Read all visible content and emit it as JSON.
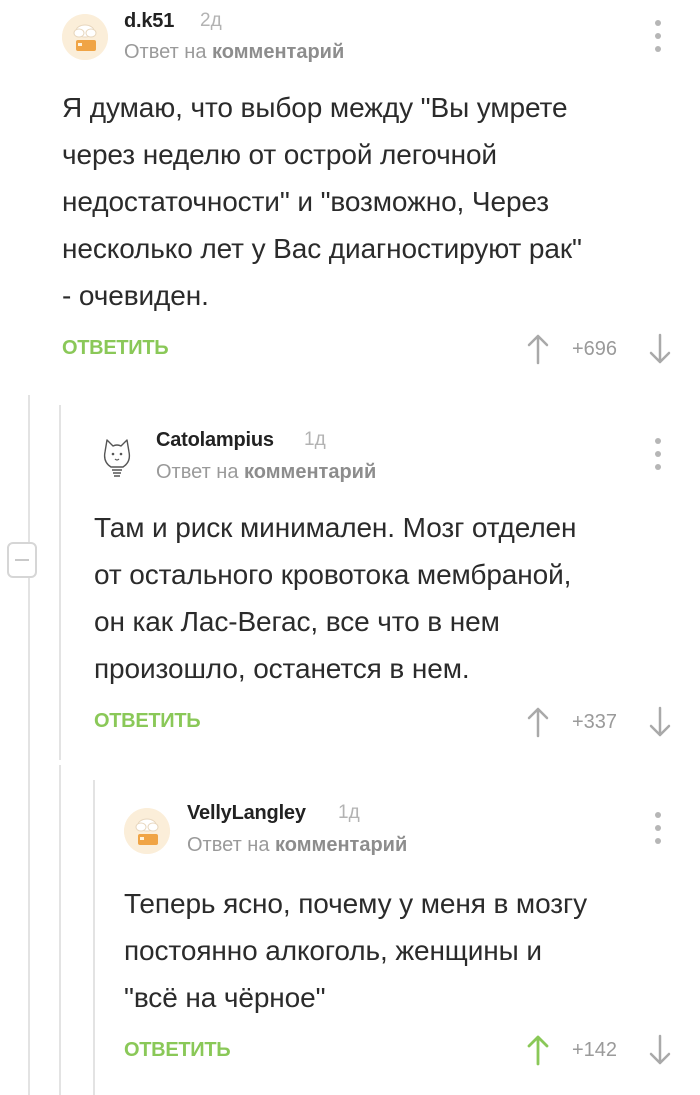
{
  "reply_label_prefix": "Ответ на",
  "reply_label_link": "комментарий",
  "reply_button": "ОТВЕТИТЬ",
  "colors": {
    "accent": "#8ac858",
    "upvote_active": "#8ac858",
    "muted": "#b3b3b3"
  },
  "comments": [
    {
      "username": "d.k51",
      "time": "2д",
      "avatar": "chef-hat-avatar",
      "lines": [
        "Я думаю, что выбор между \"Вы умрете",
        "через неделю от острой легочной",
        "недостаточности\" и \"возможно, Через",
        "несколько лет у Вас диагностируют рак\"",
        "- очевиден."
      ],
      "rating": "+696",
      "upvoted": false
    },
    {
      "username": "Catolampius",
      "time": "1д",
      "avatar": "cat-lightbulb-avatar",
      "lines": [
        "Там и риск минимален. Мозг отделен",
        "от остального кровотока мембраной,",
        "он как Лас-Вегас, все что в нем",
        "произошло, останется в нем."
      ],
      "rating": "+337",
      "upvoted": false
    },
    {
      "username": "VellyLangley",
      "time": "1д",
      "avatar": "chef-hat-avatar",
      "lines": [
        "Теперь ясно, почему у меня в мозгу",
        "постоянно алкоголь, женщины и",
        "\"всё на чёрное\""
      ],
      "rating": "+142",
      "upvoted": true
    }
  ]
}
